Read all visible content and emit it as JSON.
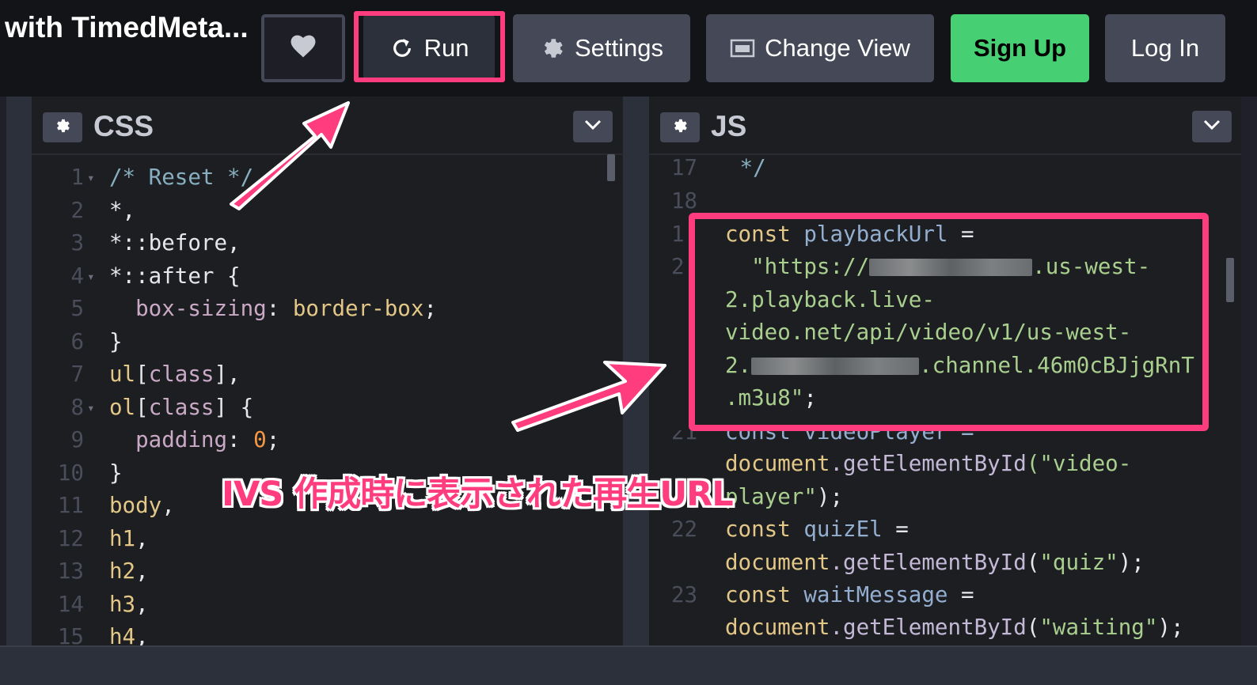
{
  "header": {
    "title": "with TimedMeta...",
    "heart_icon": "heart-icon",
    "run_label": "Run",
    "settings_label": "Settings",
    "change_view_label": "Change View",
    "signup_label": "Sign Up",
    "login_label": "Log In"
  },
  "css_panel": {
    "title": "CSS",
    "lines": [
      {
        "n": "1",
        "fold": true,
        "parts": [
          [
            "c-com",
            "/* Reset */"
          ]
        ]
      },
      {
        "n": "2",
        "parts": [
          [
            "c-sel",
            "*,"
          ]
        ]
      },
      {
        "n": "3",
        "parts": [
          [
            "c-sel",
            "*::before,"
          ]
        ]
      },
      {
        "n": "4",
        "fold": true,
        "parts": [
          [
            "c-sel",
            "*::after {"
          ]
        ]
      },
      {
        "n": "5",
        "parts": [
          [
            "c-prop",
            "  box-sizing"
          ],
          [
            "c-op",
            ": "
          ],
          [
            "c-val",
            "border-box"
          ],
          [
            "c-op",
            ";"
          ]
        ]
      },
      {
        "n": "6",
        "parts": [
          [
            "c-sel",
            "}"
          ]
        ]
      },
      {
        "n": "7",
        "parts": [
          [
            "c-val",
            "ul"
          ],
          [
            "c-op",
            "["
          ],
          [
            "c-prop",
            "class"
          ],
          [
            "c-op",
            "],"
          ]
        ]
      },
      {
        "n": "8",
        "fold": true,
        "parts": [
          [
            "c-val",
            "ol"
          ],
          [
            "c-op",
            "["
          ],
          [
            "c-prop",
            "class"
          ],
          [
            "c-op",
            "] {"
          ]
        ]
      },
      {
        "n": "9",
        "parts": [
          [
            "c-prop",
            "  padding"
          ],
          [
            "c-op",
            ": "
          ],
          [
            "c-num",
            "0"
          ],
          [
            "c-op",
            ";"
          ]
        ]
      },
      {
        "n": "10",
        "parts": [
          [
            "c-sel",
            "}"
          ]
        ]
      },
      {
        "n": "11",
        "parts": [
          [
            "c-val",
            "body"
          ],
          [
            "c-op",
            ","
          ]
        ]
      },
      {
        "n": "12",
        "parts": [
          [
            "c-val",
            "h1"
          ],
          [
            "c-op",
            ","
          ]
        ]
      },
      {
        "n": "13",
        "parts": [
          [
            "c-val",
            "h2"
          ],
          [
            "c-op",
            ","
          ]
        ]
      },
      {
        "n": "14",
        "parts": [
          [
            "c-val",
            "h3"
          ],
          [
            "c-op",
            ","
          ]
        ]
      },
      {
        "n": "15",
        "parts": [
          [
            "c-val",
            "h4"
          ],
          [
            "c-op",
            ","
          ]
        ]
      }
    ]
  },
  "js_panel": {
    "title": "JS",
    "l17": "17",
    "l17_text": " */",
    "l18": "18",
    "l19": "1",
    "l20": "2",
    "playback": {
      "kw": "const",
      "var": "playbackUrl",
      "eq": " =",
      "s1a": "\"https://",
      "s1b": ".us-west-",
      "s2": "2.playback.live-",
      "s3": "video.net/api/video/v1/us-west-",
      "s4a": "2.",
      "s4b": ".channel.46m0cBJjgRnT",
      "s5": ".m3u8\"",
      "semi": ";"
    },
    "l21": "21",
    "l21_partial": "const videoPlayer =",
    "doc1_obj": "document",
    "doc1_fn": ".getElementById",
    "doc1_str1": "(\"video-",
    "doc1_str2": "player\"",
    "doc1_end": ");",
    "l22": "22",
    "quiz_var": "quizEl",
    "quiz_str": "\"quiz\"",
    "l23": "23",
    "wait_var": "waitMessage",
    "wait_str": "\"waiting\"",
    "kw_const": "const",
    "eq": " =",
    "doc": "document",
    "getbyid": ".getElementById",
    "close": ");"
  },
  "annotation": {
    "text": "IVS 作成時に表示された再生URL",
    "color": "#ff3c7e"
  },
  "colors": {
    "accent": "#ff3c7e",
    "signup": "#47cf73",
    "topbar": "#131417"
  }
}
